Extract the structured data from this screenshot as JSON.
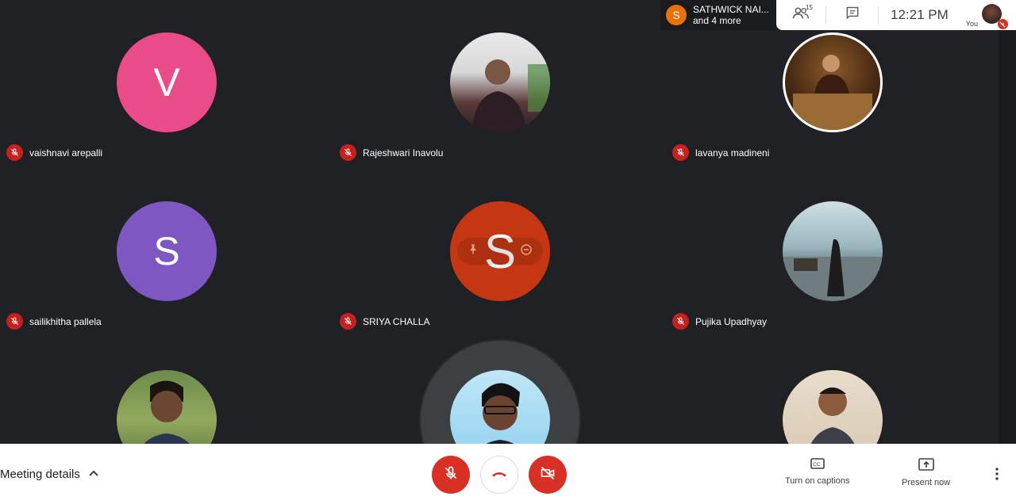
{
  "participants": [
    {
      "name": "vaishnavi arepalli",
      "initial": "V",
      "avatar_color": "#ea4c89",
      "type": "initial"
    },
    {
      "name": "Rajeshwari Inavolu",
      "type": "photo",
      "photo_icon": "person-photo"
    },
    {
      "name": "lavanya madineni",
      "type": "photo",
      "photo_icon": "person-photo"
    },
    {
      "name": "sailikhitha pallela",
      "initial": "S",
      "avatar_color": "#7e57c2",
      "type": "initial"
    },
    {
      "name": "SRIYA CHALLA",
      "initial": "S",
      "avatar_color": "#c53713",
      "type": "initial"
    },
    {
      "name": "Pujika Upadhyay",
      "type": "photo",
      "photo_icon": "landscape-photo"
    }
  ],
  "bottom_row": [
    {
      "type": "photo"
    },
    {
      "type": "photo",
      "is_self": true
    },
    {
      "type": "photo"
    }
  ],
  "presenter": {
    "initial": "S",
    "name": "SATHWICK NAI...",
    "sub": "and 4 more",
    "color": "#e8710a"
  },
  "topbar": {
    "people_count": "15",
    "time": "12:21 PM",
    "you_label": "You"
  },
  "bottombar": {
    "meeting_details": "Meeting details",
    "captions_label": "Turn on captions",
    "present_label": "Present now"
  },
  "colors": {
    "mute_red": "#c5221f",
    "end_call_red": "#d93025",
    "stage_bg": "#202124"
  }
}
